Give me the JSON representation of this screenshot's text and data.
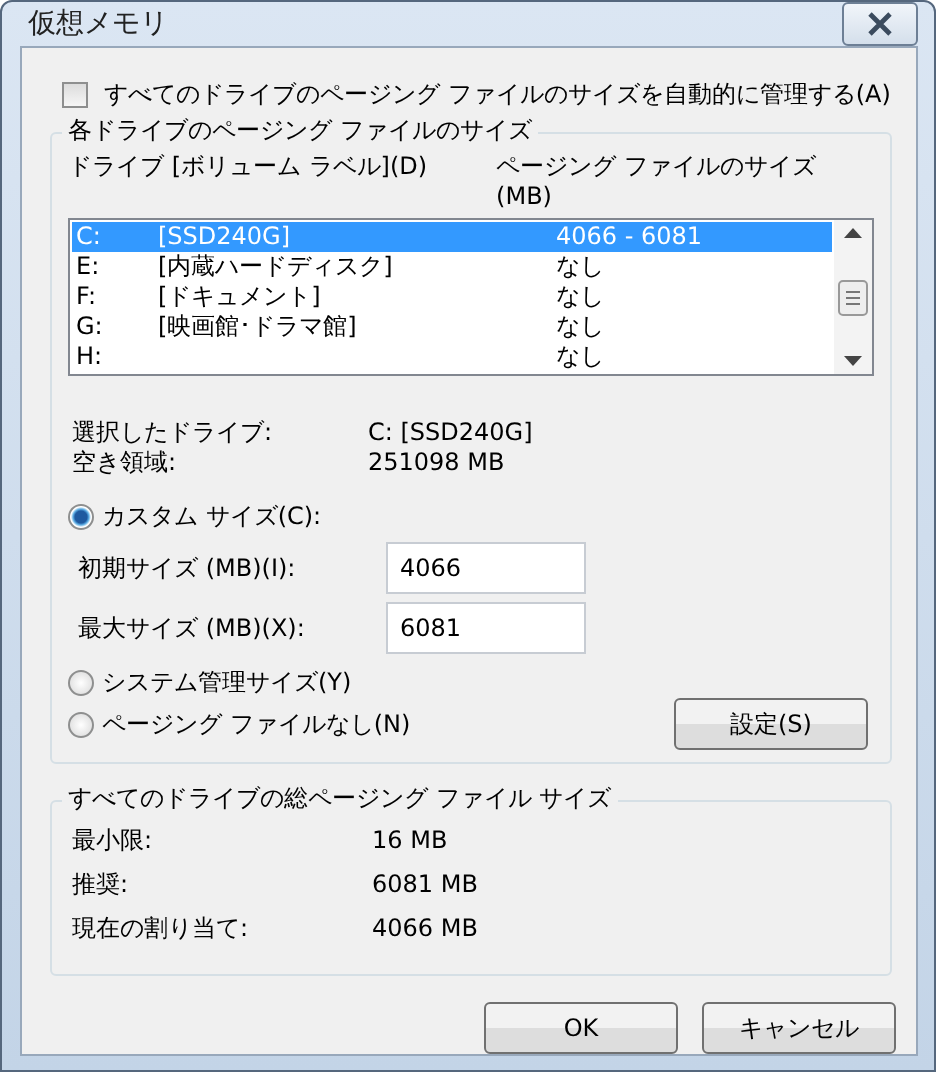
{
  "window": {
    "title": "仮想メモリ"
  },
  "auto_manage": {
    "label": "すべてのドライブのページング ファイルのサイズを自動的に管理する(A)",
    "checked": false
  },
  "drives_group": {
    "title": "各ドライブのページング ファイルのサイズ",
    "columns": [
      "ドライブ [ボリューム ラベル](D)",
      "ページング ファイルのサイズ (MB)"
    ],
    "rows": [
      {
        "drive": "C:",
        "label": "[SSD240G]",
        "size": "4066 - 6081",
        "selected": true
      },
      {
        "drive": "E:",
        "label": "[内蔵ハードディスク]",
        "size": "なし",
        "selected": false
      },
      {
        "drive": "F:",
        "label": "[ドキュメント]",
        "size": "なし",
        "selected": false
      },
      {
        "drive": "G:",
        "label": "[映画館･ドラマ館]",
        "size": "なし",
        "selected": false
      },
      {
        "drive": "H:",
        "label": "",
        "size": "なし",
        "selected": false
      }
    ],
    "info": [
      {
        "label": "選択したドライブ:",
        "value": "C:  [SSD240G]"
      },
      {
        "label": "空き領域:",
        "value": "251098 MB"
      }
    ],
    "size_options": [
      {
        "label": "カスタム サイズ(C):",
        "selected": true,
        "fields": [
          {
            "label": "初期サイズ (MB)(I):",
            "value": "4066"
          },
          {
            "label": "最大サイズ (MB)(X):",
            "value": "6081"
          }
        ]
      },
      {
        "label": "システム管理サイズ(Y)",
        "selected": false
      },
      {
        "label": "ページング ファイルなし(N)",
        "selected": false
      }
    ],
    "set_button": "設定(S)"
  },
  "totals_group": {
    "title": "すべてのドライブの総ページング ファイル サイズ",
    "rows": [
      {
        "label": "最小限:",
        "value": "16 MB"
      },
      {
        "label": "推奨:",
        "value": "6081 MB"
      },
      {
        "label": "現在の割り当て:",
        "value": "4066 MB"
      }
    ]
  },
  "buttons": [
    "OK",
    "キャンセル"
  ]
}
